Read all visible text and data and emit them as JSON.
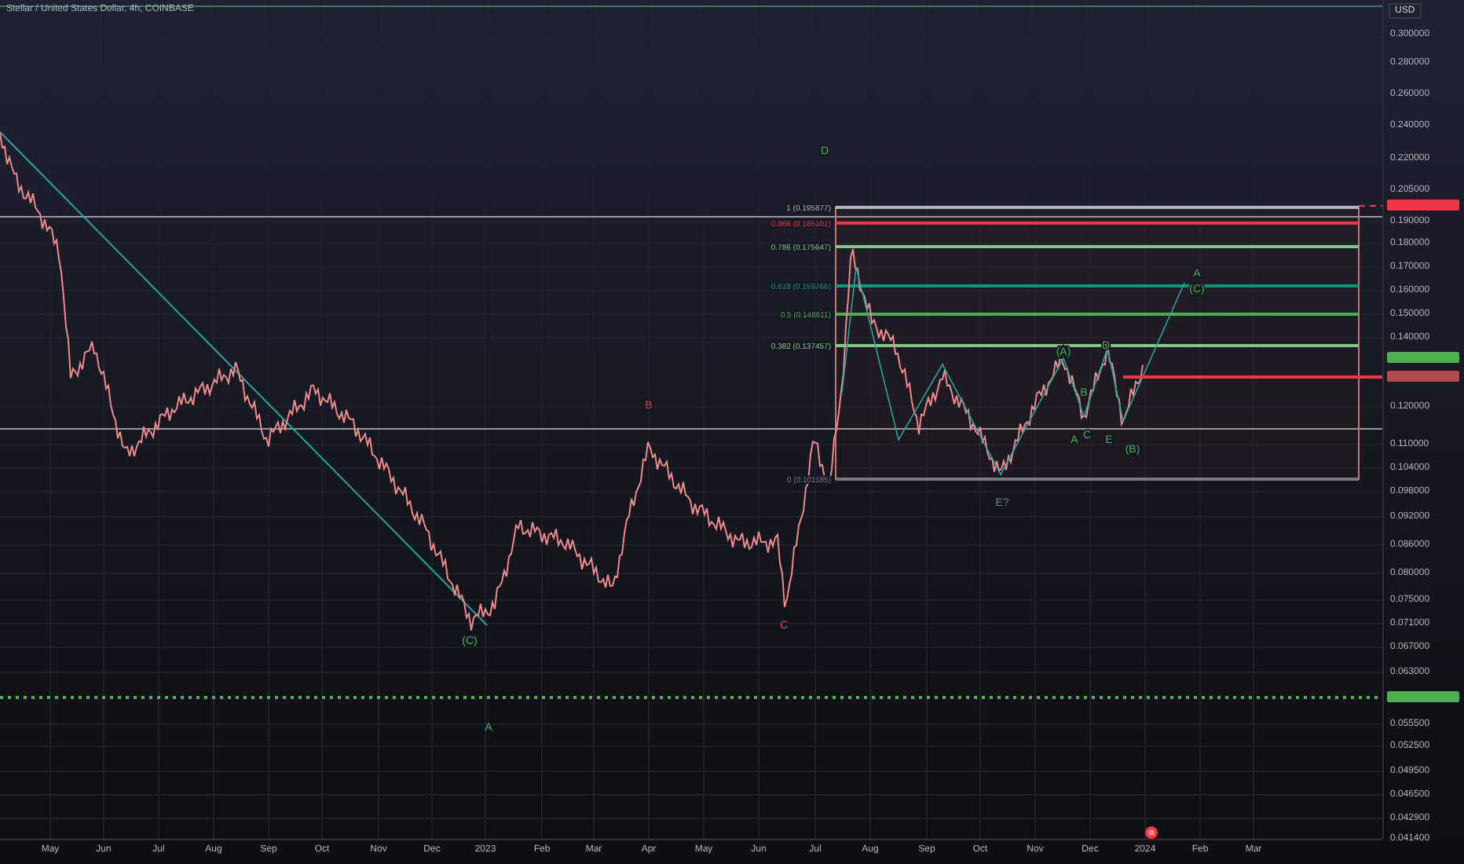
{
  "chart": {
    "title": "Stellar / United States Dollar, 4h, COINBASE",
    "currency": "USD",
    "price_axis": [
      "0.300000",
      "0.280000",
      "0.260000",
      "0.240000",
      "0.220000",
      "0.205000",
      "0.190000",
      "0.180000",
      "0.170000",
      "0.160000",
      "0.150000",
      "0.140000",
      "0.120000",
      "0.110000",
      "0.104000",
      "0.098000",
      "0.092000",
      "0.086000",
      "0.080000",
      "0.075000",
      "0.071000",
      "0.067000",
      "0.063000",
      "0.055500",
      "0.052500",
      "0.049500",
      "0.046500",
      "0.042900",
      "0.041400"
    ],
    "time_axis": [
      "May",
      "Jun",
      "Jul",
      "Aug",
      "Sep",
      "Oct",
      "Nov",
      "Dec",
      "2023",
      "Feb",
      "Mar",
      "Apr",
      "May",
      "Jun",
      "Jul",
      "Aug",
      "Sep",
      "Oct",
      "Nov",
      "Dec",
      "2024",
      "Feb",
      "Mar"
    ],
    "fib_levels": [
      {
        "label": "1 (0.195877)",
        "color": "#b2b5be"
      },
      {
        "label": "0.866 (0.185101)",
        "color": "#f23645"
      },
      {
        "label": "0.786 (0.175647)",
        "color": "#81c784"
      },
      {
        "label": "0.618 (0.159766)",
        "color": "#089981"
      },
      {
        "label": "0.5 (0.148611)",
        "color": "#4caf50"
      },
      {
        "label": "0.382 (0.137457)",
        "color": "#81c784"
      },
      {
        "label": "0 (0.101185)",
        "color": "#787b86"
      }
    ],
    "wave_labels": [
      {
        "text": "D",
        "color": "#4caf50"
      },
      {
        "text": "B",
        "color": "#f23645"
      },
      {
        "text": "C",
        "color": "#f23645"
      },
      {
        "text": "(C)",
        "color": "#4caf50"
      },
      {
        "text": "A",
        "color": "#4caf50"
      },
      {
        "text": "E?",
        "color": "#787b86"
      },
      {
        "text": "(A)",
        "color": "#4caf50"
      },
      {
        "text": "D",
        "color": "#4caf50"
      },
      {
        "text": "B",
        "color": "#4caf50"
      },
      {
        "text": "A",
        "color": "#4caf50"
      },
      {
        "text": "C",
        "color": "#4caf50"
      },
      {
        "text": "E",
        "color": "#4caf50"
      },
      {
        "text": "(B)",
        "color": "#4caf50"
      },
      {
        "text": "A",
        "color": "#4caf50"
      },
      {
        "text": "(C)",
        "color": "#4caf50"
      }
    ]
  }
}
